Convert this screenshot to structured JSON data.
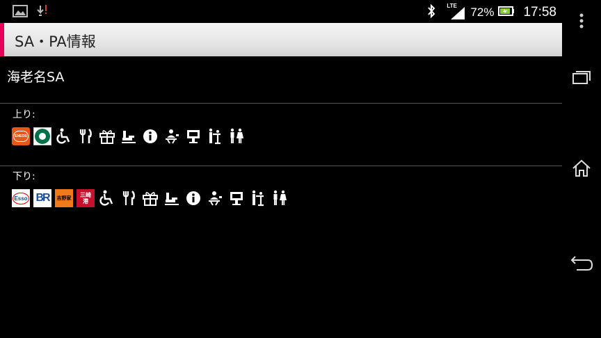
{
  "status_bar": {
    "network": "LTE",
    "battery_percent": "72%",
    "time": "17:58",
    "icons": [
      "gallery-icon",
      "download-alert-icon",
      "bluetooth-icon",
      "signal-icon",
      "battery-icon"
    ]
  },
  "action_bar": {
    "title": "SA・PA情報",
    "accent_color": "#e5005a"
  },
  "area": {
    "name": "海老名SA"
  },
  "up": {
    "label": "上り:",
    "logos": [
      {
        "name": "eneos-logo",
        "text": "ENEOS",
        "color": "#e8571a"
      },
      {
        "name": "starbucks-logo",
        "text": "",
        "color": "#00704a"
      }
    ],
    "facilities": [
      "wheelchair-icon",
      "restaurant-icon",
      "gift-shop-icon",
      "snack-corner-icon",
      "information-icon",
      "concierge-icon",
      "highway-info-terminal-icon",
      "baby-room-icon",
      "restroom-icon"
    ]
  },
  "down": {
    "label": "下り:",
    "logos": [
      {
        "name": "esso-logo",
        "text": "Esso",
        "color": "#0050a0"
      },
      {
        "name": "baskin-robbins-logo",
        "text": "BR",
        "color": "#1a4fa0"
      },
      {
        "name": "yoshinoya-logo",
        "text": "吉野家",
        "color": "#f07a1a"
      },
      {
        "name": "misakiko-logo",
        "text": "三崎港",
        "color": "#c8102e"
      }
    ],
    "facilities": [
      "wheelchair-icon",
      "restaurant-icon",
      "gift-shop-icon",
      "snack-corner-icon",
      "information-icon",
      "concierge-icon",
      "highway-info-terminal-icon",
      "baby-room-icon",
      "restroom-icon"
    ]
  }
}
